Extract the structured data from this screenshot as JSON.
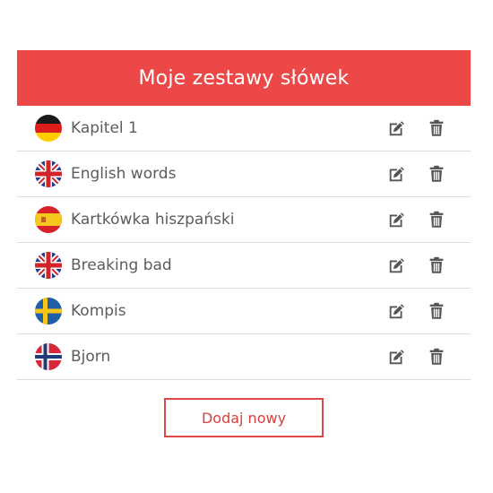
{
  "header": {
    "title": "Moje zestawy słówek"
  },
  "sets": [
    {
      "name": "Kapitel 1",
      "flag": "germany-flag-icon"
    },
    {
      "name": "English words",
      "flag": "uk-flag-icon"
    },
    {
      "name": "Kartkówka hiszpański",
      "flag": "spain-flag-icon"
    },
    {
      "name": "Breaking bad",
      "flag": "uk-flag-icon"
    },
    {
      "name": "Kompis",
      "flag": "sweden-flag-icon"
    },
    {
      "name": "Bjorn",
      "flag": "norway-flag-icon"
    }
  ],
  "actions": {
    "edit_icon": "edit-icon",
    "delete_icon": "trash-icon"
  },
  "footer": {
    "add_label": "Dodaj nowy"
  },
  "colors": {
    "accent": "#ec4848",
    "text": "#5c5c5c",
    "icon": "#555555",
    "divider": "#dcdcdc"
  }
}
